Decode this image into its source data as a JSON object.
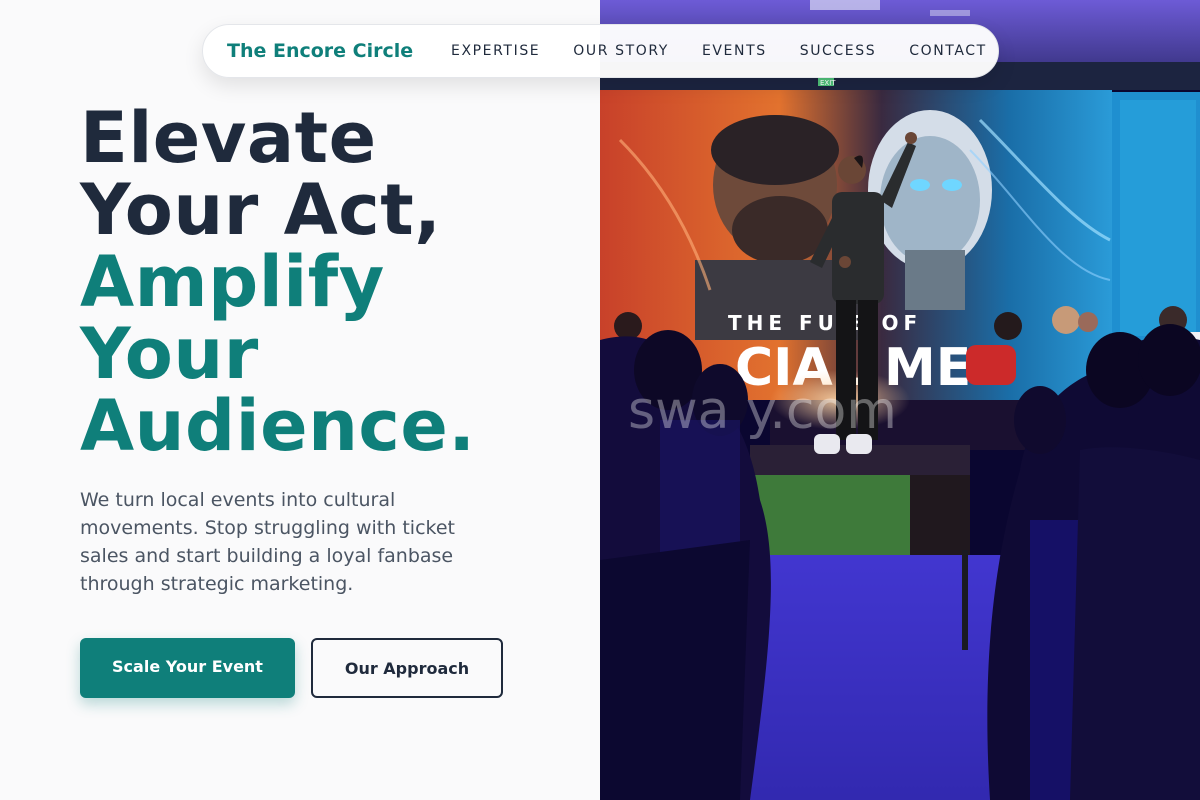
{
  "nav": {
    "brand": "The Encore Circle",
    "links": [
      "EXPERTISE",
      "OUR STORY",
      "EVENTS",
      "SUCCESS",
      "CONTACT"
    ]
  },
  "hero": {
    "headline_dark": [
      "Elevate",
      "Your Act,"
    ],
    "headline_accent": [
      "Amplify",
      "Your",
      "Audience."
    ],
    "subtext": "We turn local events into cultural movements. Stop struggling with ticket sales and start building a loyal fanbase through strategic marketing.",
    "primary_cta": "Scale Your Event",
    "secondary_cta": "Our Approach"
  },
  "photo": {
    "screen_text_top": "THE FU    E OF",
    "screen_text_bottom": "CIAL ME",
    "watermark": "swa        y.com",
    "exit_sign": "EXIT"
  },
  "colors": {
    "accent": "#0f7f7a",
    "dark": "#1f2a3c",
    "body_text": "#4b5563",
    "background": "#fafafb"
  }
}
